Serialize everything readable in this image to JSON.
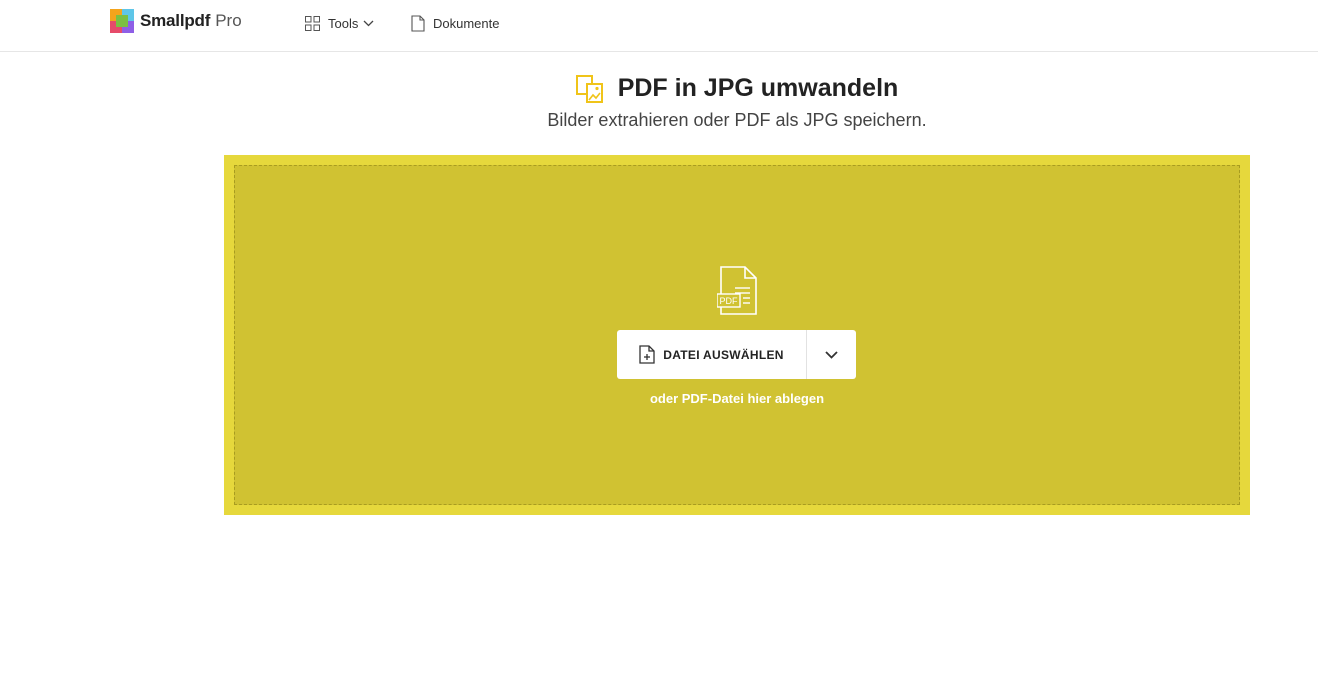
{
  "header": {
    "brand_name": "Smallpdf",
    "brand_tier": "Pro",
    "nav": {
      "tools_label": "Tools",
      "documents_label": "Dokumente"
    }
  },
  "main": {
    "title": "PDF in JPG umwandeln",
    "subtitle": "Bilder extrahieren oder PDF als JPG speichern.",
    "dropzone": {
      "file_badge": "PDF",
      "choose_file_label": "DATEI AUSWÄHLEN",
      "drop_hint": "oder PDF-Datei hier ablegen"
    }
  },
  "colors": {
    "accent": "#e6d83c",
    "dropzone_inner": "#d0c232",
    "title_icon": "#f0c419"
  },
  "icons": {
    "tools": "grid-icon",
    "tools_chevron": "chevron-down-icon",
    "documents": "document-icon",
    "title": "pdf-to-jpg-icon",
    "illustration": "pdf-file-icon",
    "choose": "file-add-icon",
    "dropdown": "chevron-down-icon"
  }
}
